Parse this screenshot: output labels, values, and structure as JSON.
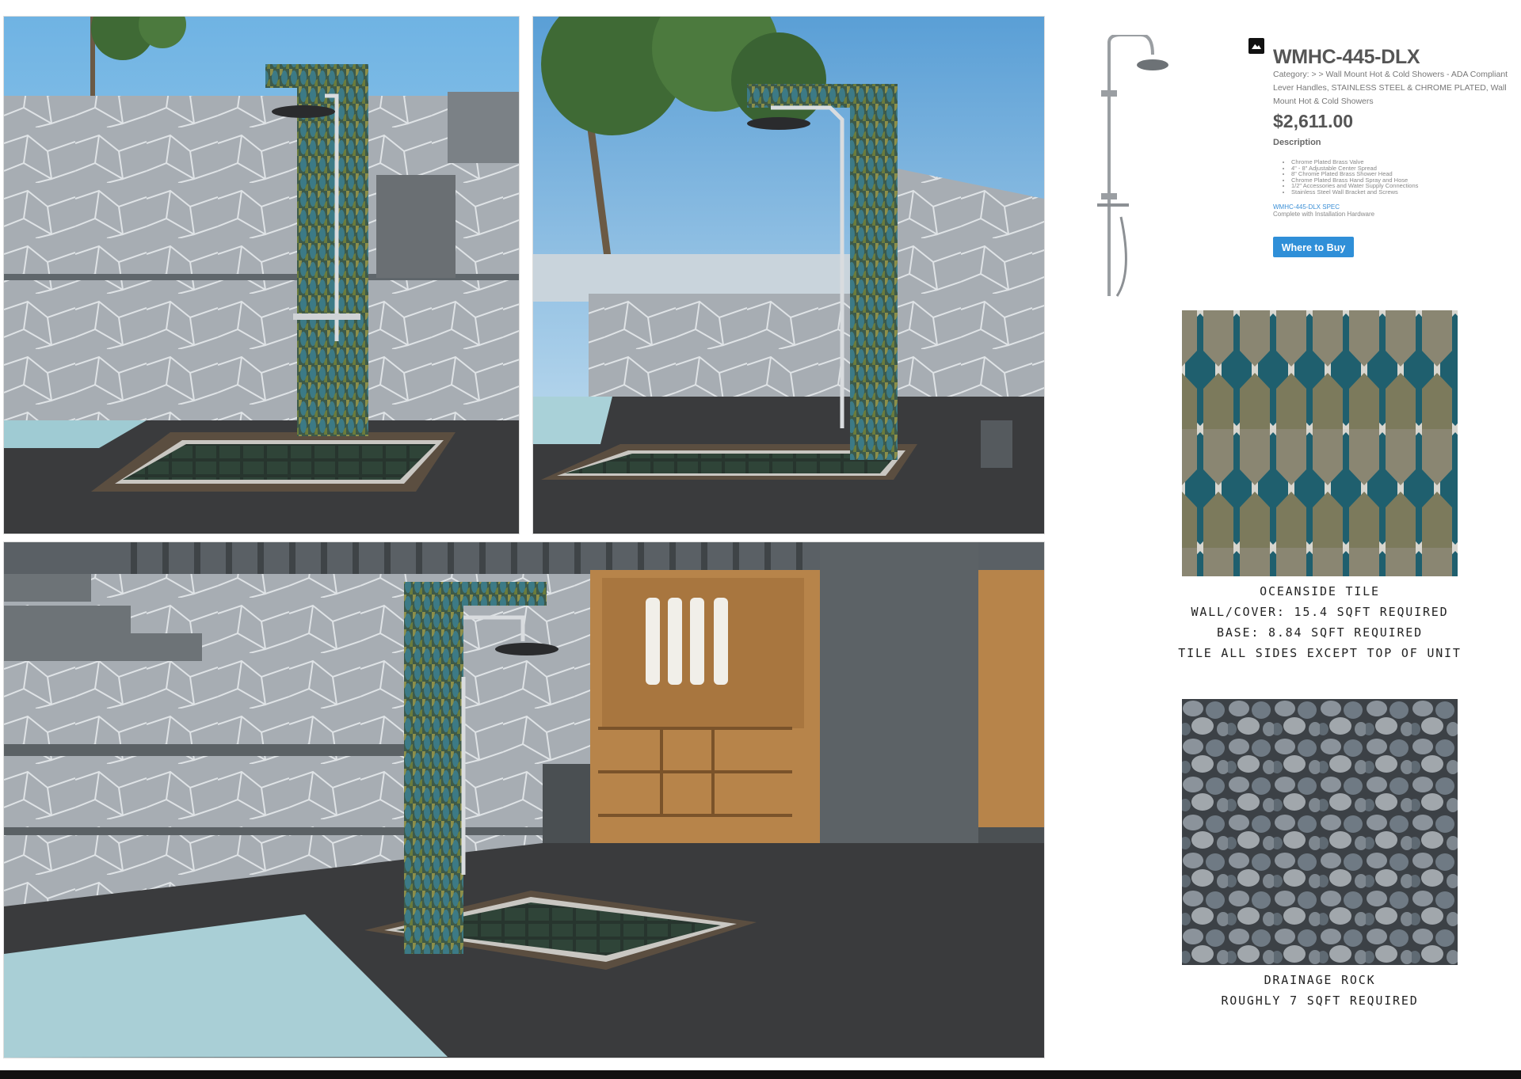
{
  "product": {
    "title": "WMHC-445-DLX",
    "category": "Category: > > Wall Mount Hot & Cold Showers - ADA Compliant Lever Handles, STAINLESS STEEL & CHROME PLATED, Wall Mount Hot & Cold Showers",
    "price": "$2,611.00",
    "description_heading": "Description",
    "description_items": [
      "Chrome Plated Brass Valve",
      "4\" - 8\" Adjustable Center Spread",
      "8\" Chrome Plated Brass Shower Head",
      "Chrome Plated Brass Hand Spray and Hose",
      "1/2\" Accessories and Water Supply Connections",
      "Stainless Steel Wall Bracket and Screws"
    ],
    "spec_link": "WMHC-445-DLX SPEC",
    "spec_note": "Complete with Installation Hardware",
    "buy_button": "Where to Buy",
    "button_color": "#2f8fd8"
  },
  "tile": {
    "caption_lines": [
      "OCEANSIDE TILE",
      "WALL/COVER: 15.4 SQFT REQUIRED",
      "BASE: 8.84 SQFT REQUIRED",
      "TILE ALL SIDES EXCEPT TOP OF UNIT"
    ]
  },
  "rock": {
    "caption_lines": [
      "DRAINAGE ROCK",
      "ROUGHLY 7 SQFT REQUIRED"
    ]
  },
  "colors": {
    "sky": "#8fc4e6",
    "stone": "#9aa0a6",
    "deck": "#3a3b3d",
    "tile_teal": "#1f5f6e",
    "wood": "#b7844a",
    "water": "#a9cfd6"
  }
}
